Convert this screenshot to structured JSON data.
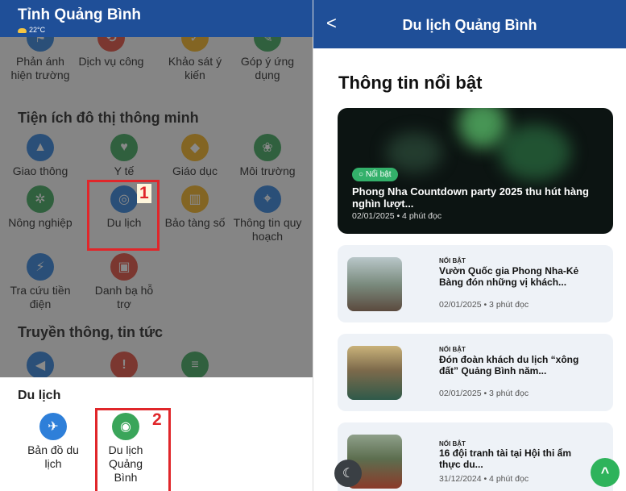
{
  "left": {
    "header_title": "Tỉnh Quảng Bình",
    "weather": "22°C",
    "top_row": [
      "Phản ánh hiện trường",
      "Dịch vụ công",
      "Khảo sát ý kiến",
      "Góp ý ứng dụng"
    ],
    "section_smart": "Tiện ích đô thị thông minh",
    "smart_row1": [
      "Giao thông",
      "Y tế",
      "Giáo dục",
      "Môi trường"
    ],
    "smart_row2": [
      "Nông nghiệp",
      "Du lịch",
      "Bảo tàng số",
      "Thông tin quy hoạch"
    ],
    "smart_row3": [
      "Tra cứu tiền điện",
      "Danh bạ hỗ trợ"
    ],
    "section_news": "Truyền thông, tin tức",
    "marker1": "1",
    "marker2": "2",
    "popup_title": "Du lịch",
    "popup_items": [
      "Bản đồ du lịch",
      "Du lịch Quảng Bình"
    ]
  },
  "right": {
    "back_label": "<",
    "title": "Du lịch Quảng Bình",
    "featured_heading": "Thông tin nổi bật",
    "hero": {
      "badge": "○ Nổi bật",
      "title": "Phong Nha Countdown party 2025 thu hút hàng nghìn lượt...",
      "meta": "02/01/2025 • 4 phút đọc"
    },
    "news": [
      {
        "tag": "NỔI BẬT",
        "title": "Vườn Quốc gia Phong Nha-Kẻ Bàng đón những vị khách...",
        "meta": "02/01/2025 • 3 phút đọc"
      },
      {
        "tag": "NỔI BẬT",
        "title": "Đón đoàn khách du lịch “xông đất” Quảng Bình năm...",
        "meta": "02/01/2025 • 3 phút đọc"
      },
      {
        "tag": "NỔI BẬT",
        "title": "16 đội tranh tài tại Hội thi ẩm thực du...",
        "meta": "31/12/2024 • 4 phút đọc"
      }
    ],
    "moon_icon": "☾",
    "top_icon": "^"
  },
  "colors": {
    "header_blue": "#1f4f98",
    "accent_green": "#2eb35b",
    "highlight_red": "#e0262a"
  }
}
